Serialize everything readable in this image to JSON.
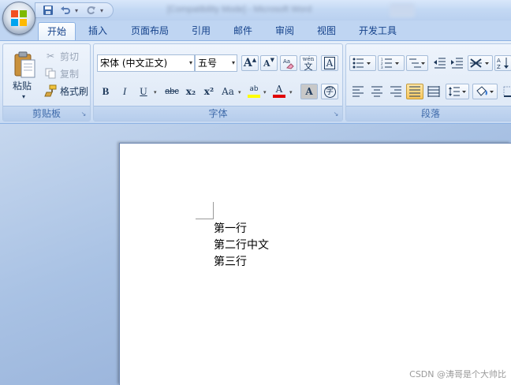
{
  "titlebar": {
    "title": "[Compatibility Mode] - Microsoft Word",
    "office_button_icon": "office-logo-icon",
    "qat": {
      "save_icon": "save-icon",
      "undo_icon": "undo-icon",
      "redo_icon": "redo-icon",
      "customize_icon": "customize-qat-icon"
    }
  },
  "tabs": [
    {
      "label": "开始",
      "active": true
    },
    {
      "label": "插入"
    },
    {
      "label": "页面布局"
    },
    {
      "label": "引用"
    },
    {
      "label": "邮件"
    },
    {
      "label": "审阅"
    },
    {
      "label": "视图"
    },
    {
      "label": "开发工具"
    }
  ],
  "clipboard": {
    "group_label": "剪贴板",
    "paste_label": "粘贴",
    "cut_label": "剪切",
    "copy_label": "复制",
    "format_painter_label": "格式刷"
  },
  "font": {
    "group_label": "字体",
    "font_name": "宋体 (中文正文)",
    "font_size": "五号",
    "grow_label": "A",
    "shrink_label": "A",
    "phonetic_label": "wén",
    "phonetic_char": "文",
    "border_char": "A",
    "bold": "B",
    "italic": "I",
    "underline": "U",
    "strike": "abc",
    "subscript": "x₂",
    "superscript": "x²",
    "case": "Aa",
    "highlight_label": "ab",
    "font_color_label": "A",
    "shade_label": "A",
    "enclose_label": "字",
    "highlight_color": "#ffff00",
    "font_color": "#e00000"
  },
  "paragraph": {
    "group_label": "段落"
  },
  "document": {
    "lines": [
      "第一行",
      "第二行中文",
      "第三行"
    ]
  },
  "watermark": "CSDN @涛哥是个大帅比",
  "colors": {
    "accent": "#15428b",
    "ribbon_bg": "#dbe7f7",
    "active_tab": "#ffffff"
  }
}
